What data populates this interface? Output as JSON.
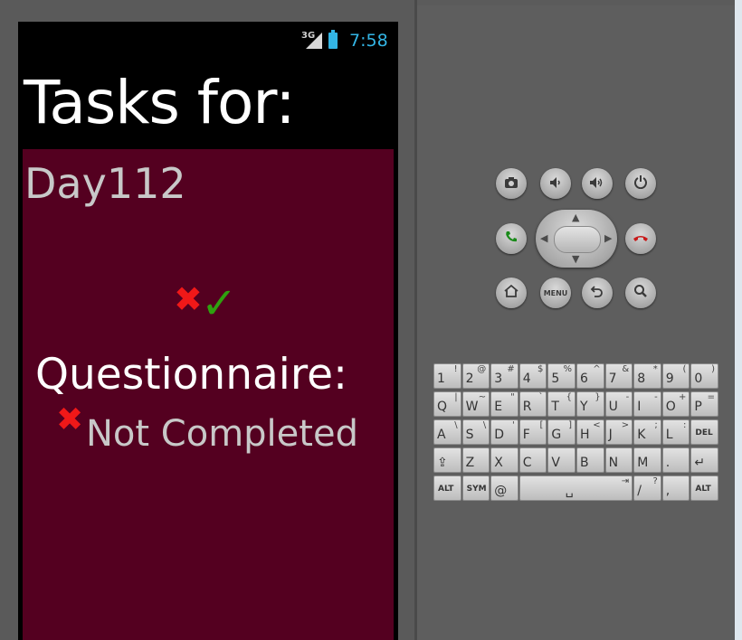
{
  "status_bar": {
    "network": "3G",
    "time": "7:58",
    "accent_color": "#33b5e5"
  },
  "app": {
    "title": "Tasks for:",
    "day": "Day112",
    "content_bg": "#540020",
    "task_icons": {
      "x_icon": "✖",
      "check_icon": "✓"
    },
    "questionnaire": {
      "label": "Questionnaire:",
      "status_icon": "✖",
      "status": "Not Completed"
    }
  },
  "hardware_buttons": [
    "camera-icon",
    "volume-down-icon",
    "volume-up-icon",
    "power-icon",
    "call-icon",
    "end-call-icon",
    "home-icon",
    "menu",
    "back-icon",
    "search-icon"
  ],
  "hardware_labels": {
    "menu": "MENU"
  },
  "keyboard": {
    "row1": [
      [
        "1",
        "!"
      ],
      [
        "2",
        "@"
      ],
      [
        "3",
        "#"
      ],
      [
        "4",
        "$"
      ],
      [
        "5",
        "%"
      ],
      [
        "6",
        "^"
      ],
      [
        "7",
        "&"
      ],
      [
        "8",
        "*"
      ],
      [
        "9",
        "("
      ],
      [
        "0",
        ")"
      ]
    ],
    "row2": [
      [
        "Q",
        "|"
      ],
      [
        "W",
        "~"
      ],
      [
        "E",
        "\""
      ],
      [
        "R",
        "`"
      ],
      [
        "T",
        "{"
      ],
      [
        "Y",
        "}"
      ],
      [
        "U",
        "-"
      ],
      [
        "I",
        "-"
      ],
      [
        "O",
        "+"
      ],
      [
        "P",
        "="
      ]
    ],
    "row3": [
      [
        "A",
        "\\"
      ],
      [
        "S",
        "\\"
      ],
      [
        "D",
        "'"
      ],
      [
        "F",
        "["
      ],
      [
        "G",
        "]"
      ],
      [
        "H",
        "<"
      ],
      [
        "J",
        ">"
      ],
      [
        "K",
        ";"
      ],
      [
        "L",
        ":"
      ],
      [
        "DEL",
        ""
      ]
    ],
    "row4": [
      [
        "⇪",
        ""
      ],
      [
        "Z",
        ""
      ],
      [
        "X",
        ""
      ],
      [
        "C",
        ""
      ],
      [
        "V",
        ""
      ],
      [
        "B",
        ""
      ],
      [
        "N",
        ""
      ],
      [
        "M",
        ""
      ],
      [
        ".",
        ""
      ],
      [
        "↵",
        ""
      ]
    ],
    "row5": [
      [
        "ALT",
        ""
      ],
      [
        "SYM",
        ""
      ],
      [
        "@",
        ""
      ],
      [
        "␣",
        "⇥"
      ],
      [
        "/",
        "?"
      ],
      [
        ",",
        ""
      ],
      [
        "ALT",
        ""
      ]
    ]
  }
}
